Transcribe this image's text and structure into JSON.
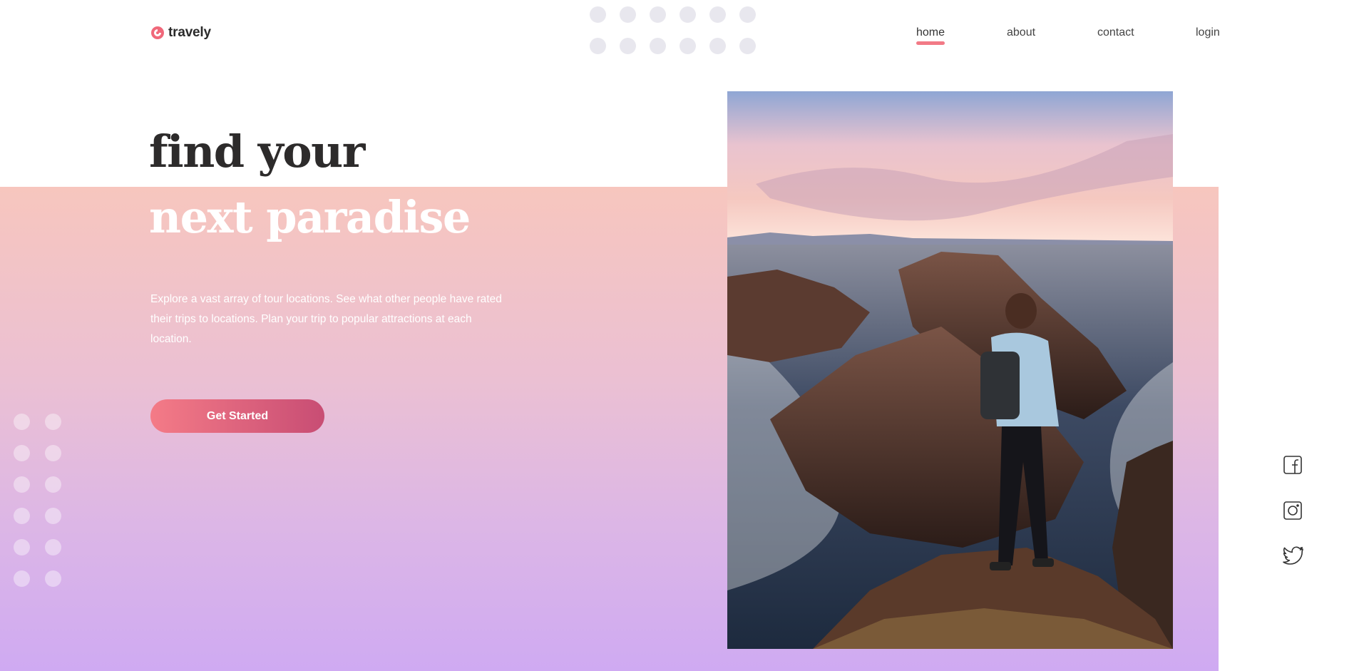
{
  "brand": {
    "name": "travely",
    "accent": "#f27a86",
    "logo_icon": "swirl-logo-icon"
  },
  "nav": {
    "items": [
      {
        "label": "home",
        "active": true
      },
      {
        "label": "about",
        "active": false
      },
      {
        "label": "contact",
        "active": false
      },
      {
        "label": "login",
        "active": false
      }
    ]
  },
  "hero": {
    "title_line1": "find your",
    "title_line2": "next paradise",
    "description": "Explore a vast array of tour locations. See what other people have rated their trips to locations. Plan your trip to popular attractions at each location.",
    "cta_label": "Get Started",
    "image": "hiker-standing-on-sea-cliff-at-sunset"
  },
  "social": [
    {
      "icon": "facebook-icon"
    },
    {
      "icon": "instagram-icon"
    },
    {
      "icon": "twitter-icon"
    }
  ],
  "colors": {
    "gradient_top": "#f7c6be",
    "gradient_bottom": "#cfaaf2",
    "button_start": "#f47b87",
    "button_end": "#c84d74"
  }
}
